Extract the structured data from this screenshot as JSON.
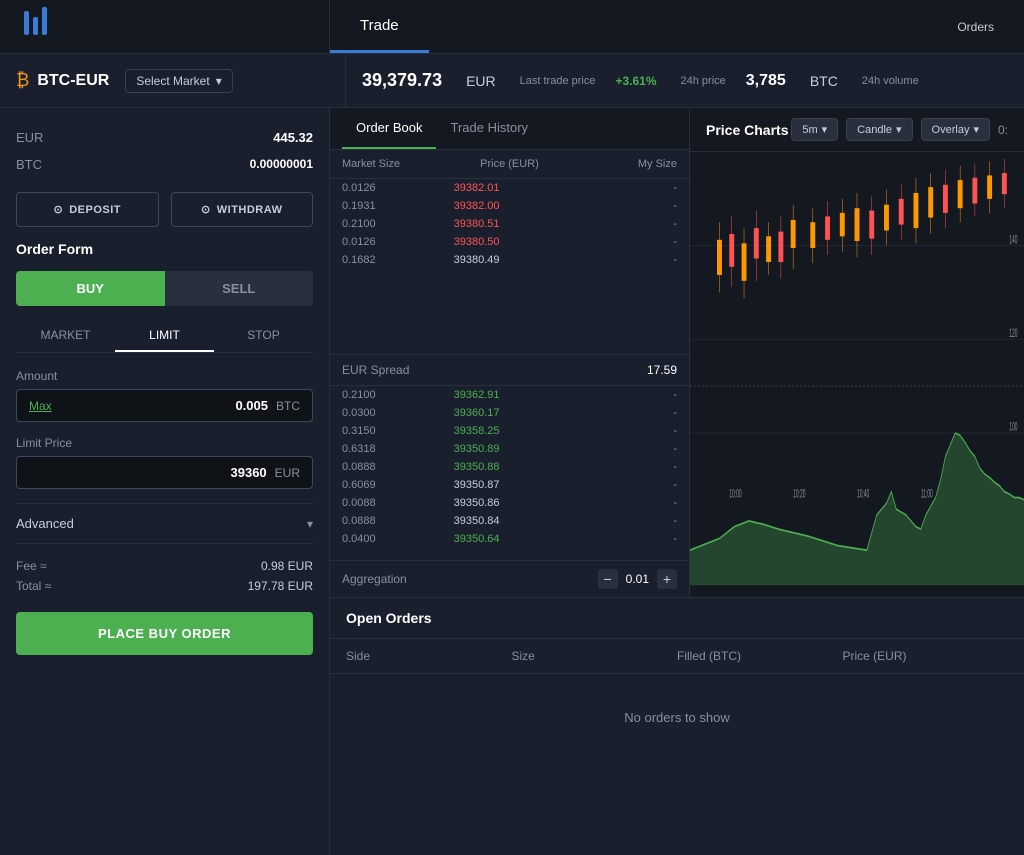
{
  "app": {
    "logo": "|||",
    "nav": {
      "trade_label": "Trade",
      "orders_label": "Orders"
    }
  },
  "market": {
    "icon": "₿",
    "pair": "BTC-EUR",
    "select_label": "Select Market",
    "last_trade_price": "39,379.73",
    "last_trade_currency": "EUR",
    "last_trade_label": "Last trade price",
    "change_24h": "+3.61%",
    "change_label": "24h price",
    "volume_24h": "3,785",
    "volume_currency": "BTC",
    "volume_label": "24h volume"
  },
  "left_panel": {
    "eur_label": "EUR",
    "eur_balance": "445.32",
    "btc_label": "BTC",
    "btc_balance": "0.00000001",
    "deposit_label": "DEPOSIT",
    "withdraw_label": "WITHDRAW",
    "order_form_title": "Order Form",
    "buy_label": "BUY",
    "sell_label": "SELL",
    "order_types": [
      "MARKET",
      "LIMIT",
      "STOP"
    ],
    "active_order_type": "LIMIT",
    "amount_label": "Amount",
    "max_label": "Max",
    "amount_value": "0.005",
    "amount_unit": "BTC",
    "limit_price_label": "Limit Price",
    "limit_price_value": "39360",
    "limit_price_unit": "EUR",
    "advanced_label": "Advanced",
    "fee_label": "Fee ≈",
    "fee_value": "0.98",
    "fee_currency": "EUR",
    "total_label": "Total ≈",
    "total_value": "197.78",
    "total_currency": "EUR",
    "place_order_label": "PLACE BUY ORDER"
  },
  "order_book": {
    "tabs": [
      "Order Book",
      "Trade History"
    ],
    "active_tab": "Order Book",
    "section_title": "Order Book",
    "headers": [
      "Market Size",
      "Price (EUR)",
      "My Size"
    ],
    "sell_rows": [
      {
        "size": "0.0126",
        "price": "39382.01",
        "my_size": "-"
      },
      {
        "size": "0.1931",
        "price": "39382.00",
        "my_size": "-"
      },
      {
        "size": "0.2100",
        "price": "39380.51",
        "my_size": "-"
      },
      {
        "size": "0.0126",
        "price": "39380.50",
        "my_size": "-"
      },
      {
        "size": "0.1682",
        "price": "39380.49",
        "my_size": "-"
      }
    ],
    "spread_label": "EUR Spread",
    "spread_value": "17.59",
    "buy_rows": [
      {
        "size": "0.2100",
        "price": "39362.91",
        "my_size": "-"
      },
      {
        "size": "0.0300",
        "price": "39360.17",
        "my_size": "-"
      },
      {
        "size": "0.3150",
        "price": "39358.25",
        "my_size": "-"
      },
      {
        "size": "0.6318",
        "price": "39350.89",
        "my_size": "-"
      },
      {
        "size": "0.0888",
        "price": "39350.88",
        "my_size": "-"
      },
      {
        "size": "0.6069",
        "price": "39350.87",
        "my_size": "-"
      },
      {
        "size": "0.0088",
        "price": "39350.86",
        "my_size": "-"
      },
      {
        "size": "0.0888",
        "price": "39350.84",
        "my_size": "-"
      },
      {
        "size": "0.0400",
        "price": "39350.64",
        "my_size": "-"
      }
    ],
    "aggregation_label": "Aggregation",
    "aggregation_value": "0.01"
  },
  "price_charts": {
    "title": "Price Charts",
    "timeframe": "5m",
    "chart_type": "Candle",
    "overlay_label": "Overlay",
    "time_labels": [
      "10:00",
      "10:20",
      "10:40",
      "11:00"
    ],
    "price_levels": [
      "140",
      "120",
      "100"
    ]
  },
  "open_orders": {
    "title": "Open Orders",
    "columns": [
      "Side",
      "Size",
      "Filled (BTC)",
      "Price (EUR)"
    ],
    "no_orders_text": "No orders to show"
  }
}
